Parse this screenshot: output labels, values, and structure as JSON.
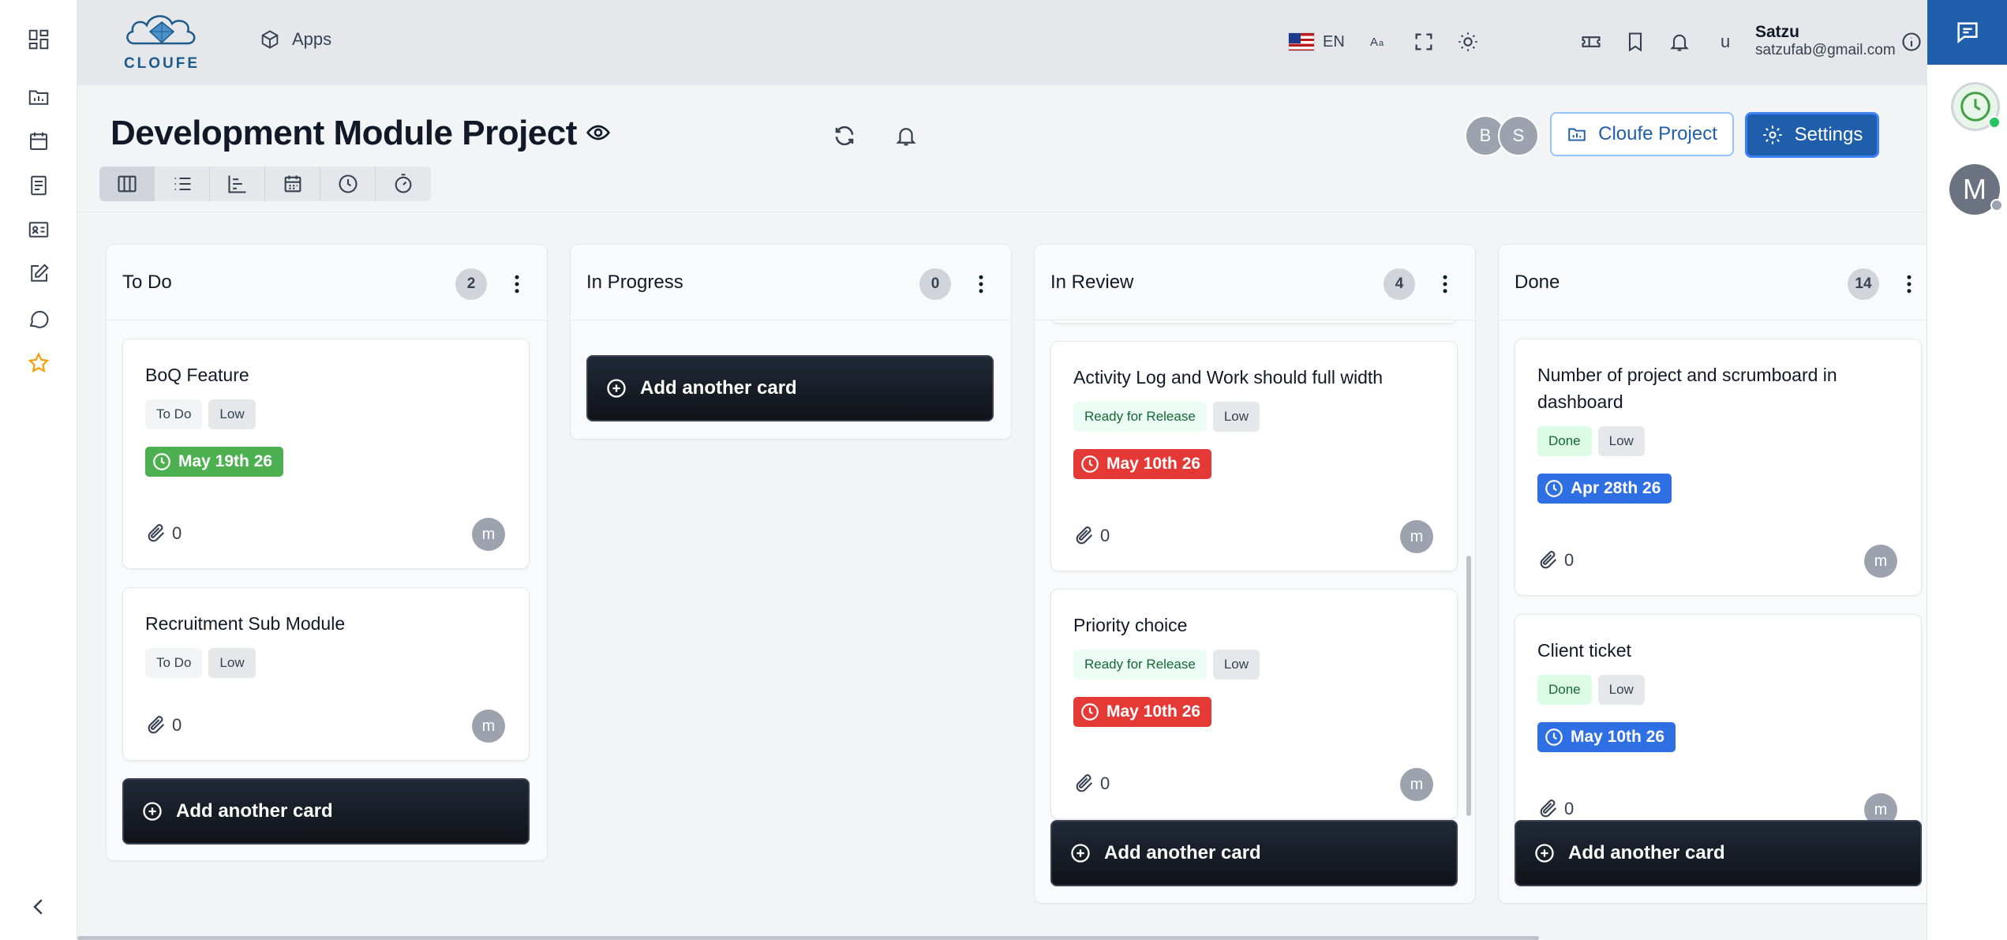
{
  "header": {
    "logo_text": "CLOUFE",
    "apps_label": "Apps",
    "language": "EN",
    "user_initial": "u",
    "user_name": "Satzu",
    "user_email": "satzufab@gmail.com"
  },
  "right_rail": {
    "avatar_initial": "M"
  },
  "project": {
    "title": "Development Module Project",
    "members": [
      {
        "initial": "B",
        "color": "#9ca3af"
      },
      {
        "initial": "S",
        "color": "#9ca3af"
      }
    ],
    "project_button": "Cloufe Project",
    "settings_button": "Settings"
  },
  "board": {
    "add_card_label": "Add another card",
    "columns": [
      {
        "title": "To Do",
        "count": "2",
        "cards": [
          {
            "title": "BoQ Feature",
            "status": "To Do",
            "priority": "Low",
            "due": "May 19th 26",
            "due_color": "#4caf50",
            "attachments": "0",
            "assignee": "m"
          },
          {
            "title": "Recruitment Sub Module",
            "status": "To Do",
            "priority": "Low",
            "due": "",
            "attachments": "0",
            "assignee": "m"
          }
        ]
      },
      {
        "title": "In Progress",
        "count": "0",
        "cards": []
      },
      {
        "title": "In Review",
        "count": "4",
        "cards": [
          {
            "title": "Activity Log and Work should full width",
            "status": "Ready for Release",
            "priority": "Low",
            "due": "May 10th 26",
            "due_color": "#e53935",
            "attachments": "0",
            "assignee": "m"
          },
          {
            "title": "Priority choice",
            "status": "Ready for Release",
            "priority": "Low",
            "due": "May 10th 26",
            "due_color": "#e53935",
            "attachments": "0",
            "assignee": "m"
          }
        ]
      },
      {
        "title": "Done",
        "count": "14",
        "cards": [
          {
            "title": "Number of project and scrumboard in dashboard",
            "status": "Done",
            "priority": "Low",
            "due": "Apr 28th 26",
            "due_color": "#2f6fe4",
            "attachments": "0",
            "assignee": "m"
          },
          {
            "title": "Client ticket",
            "status": "Done",
            "priority": "Low",
            "due": "May 10th 26",
            "due_color": "#2f6fe4",
            "attachments": "0",
            "assignee": "m"
          }
        ]
      }
    ]
  },
  "colors": {
    "primary": "#1e5eab",
    "overdue": "#e53935",
    "on_track": "#4caf50",
    "upcoming": "#2f6fe4"
  }
}
